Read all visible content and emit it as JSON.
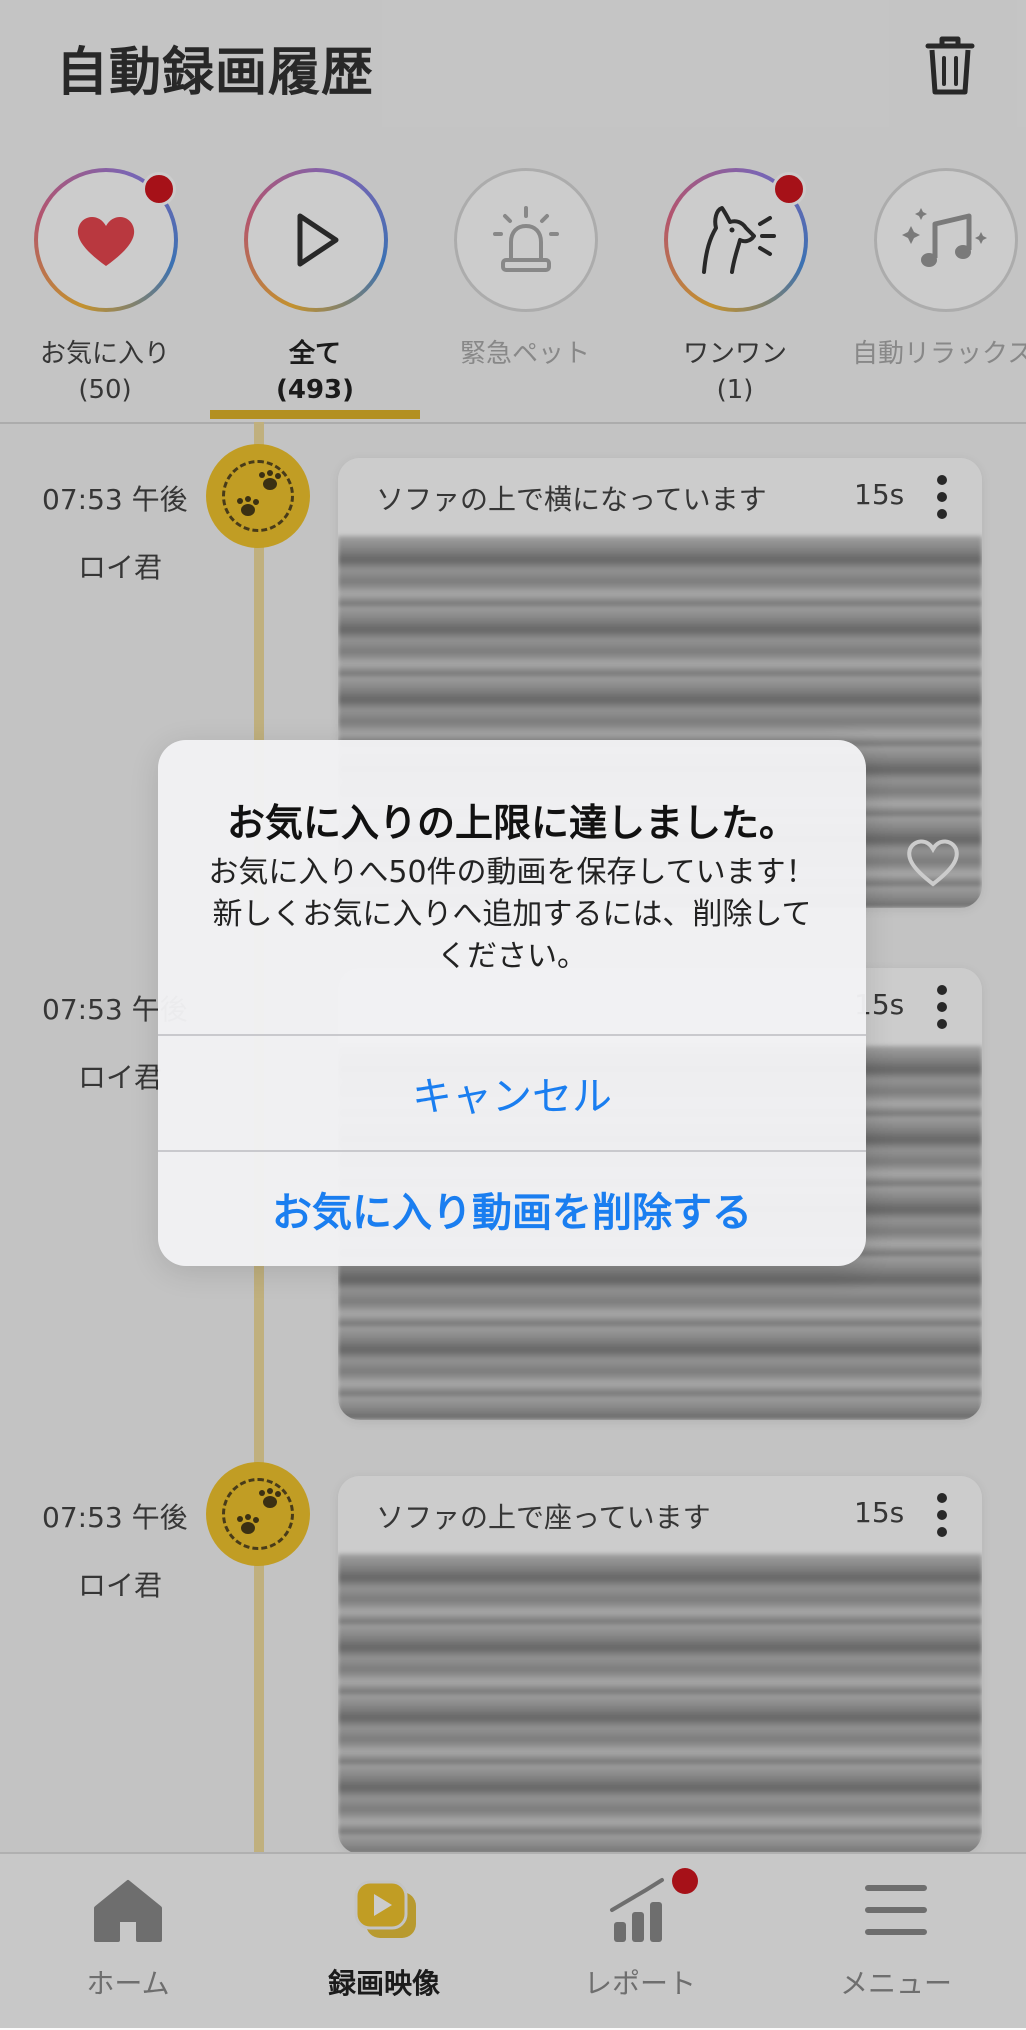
{
  "header": {
    "title": "自動録画履歴"
  },
  "categories": [
    {
      "label": "お気に入り",
      "count": "(50)",
      "icon": "heart-icon"
    },
    {
      "label": "全て",
      "count": "(493)",
      "icon": "play-icon"
    },
    {
      "label": "緊急ペット",
      "count": "",
      "icon": "alarm-icon"
    },
    {
      "label": "ワンワン",
      "count": "(1)",
      "icon": "barking-dog-icon"
    },
    {
      "label": "自動リラックス",
      "count": "",
      "icon": "music-sparkle-icon"
    }
  ],
  "entries": [
    {
      "time": "07:53 午後",
      "pet": "ロイ君",
      "caption": "ソファの上で横になっています",
      "duration": "15s"
    },
    {
      "time": "07:53 午後",
      "pet": "ロイ君",
      "caption": "",
      "duration": "15s"
    },
    {
      "time": "07:53 午後",
      "pet": "ロイ君",
      "caption": "ソファの上で座っています",
      "duration": "15s"
    }
  ],
  "dialog": {
    "title": "お気に入りの上限に達しました。",
    "message": "お気に入りへ50件の動画を保存しています！新しくお気に入りへ追加するには、削除してください。",
    "cancel_label": "キャンセル",
    "delete_label": "お気に入り動画を削除する"
  },
  "nav": {
    "home": "ホーム",
    "recordings": "録画映像",
    "report": "レポート",
    "menu": "メニュー"
  },
  "colors": {
    "accent": "#e0b52a",
    "badge": "#f2c52e",
    "alert_dot": "#d0161f",
    "link": "#1a7ef0"
  }
}
